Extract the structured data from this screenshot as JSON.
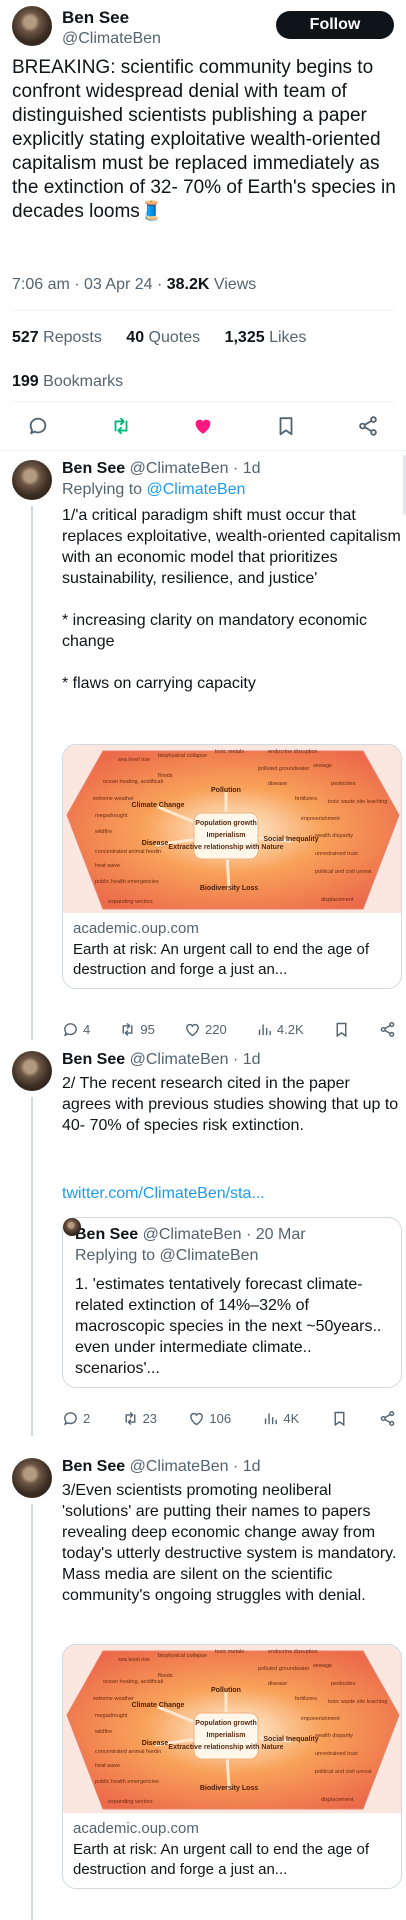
{
  "main": {
    "name": "Ben See",
    "handle": "@ClimateBen",
    "follow_label": "Follow",
    "text": "BREAKING:  scientific community begins to confront widespread denial with team of distinguished scientists publishing a paper explicitly stating exploitative wealth-oriented capitalism must be replaced immediately as the extinction of 32- 70% of Earth's species in decades looms🧵",
    "time": "7:06 am · 03 Apr 24 · ",
    "views_count": "38.2K",
    "views_label": " Views",
    "reposts_count": "527",
    "reposts_label": " Reposts",
    "quotes_count": "40",
    "quotes_label": " Quotes",
    "likes_count": "1,325",
    "likes_label": " Likes",
    "bookmarks_count": "199",
    "bookmarks_label": " Bookmarks"
  },
  "replies": [
    {
      "name": "Ben See",
      "handle_time": " @ClimateBen · 1d",
      "replying_prefix": "Replying to ",
      "replying_to": "@ClimateBen",
      "text": "1/'a critical paradigm shift must occur that replaces exploitative, wealth-oriented capitalism with an economic model that prioritizes sustainability, resilience, and justice'\n\n* increasing clarity on mandatory economic change\n\n* flaws on carrying capacity",
      "card": {
        "domain": "academic.oup.com",
        "title": "Earth at risk: An urgent call to end the age of destruction and forge a just an..."
      },
      "actions": {
        "replies": "4",
        "reposts": "95",
        "likes": "220",
        "views": "4.2K"
      }
    },
    {
      "name": "Ben See",
      "handle_time": " @ClimateBen · 1d",
      "text": "2/ The recent research cited in the paper agrees with previous studies showing that up to 40- 70% of species risk extinction.",
      "link": "twitter.com/ClimateBen/sta...",
      "quote": {
        "name": "Ben See",
        "handle_time": " @ClimateBen · 20 Mar",
        "replying": "Replying to @ClimateBen",
        "text": "1. 'estimates tentatively forecast climate-related extinction of 14%–32% of macroscopic species in the next ~50years.. even under intermediate climate.. scenarios'..."
      },
      "actions": {
        "replies": "2",
        "reposts": "23",
        "likes": "106",
        "views": "4K"
      }
    },
    {
      "name": "Ben See",
      "handle_time": " @ClimateBen · 1d",
      "text": "3/Even scientists promoting neoliberal 'solutions' are putting their names to papers revealing deep economic change away from today's utterly destructive system is mandatory. Mass media are silent on the scientific community's ongoing struggles with denial.",
      "card": {
        "domain": "academic.oup.com",
        "title": "Earth at risk: An urgent call to end the age of destruction and forge a just an..."
      }
    }
  ],
  "infographic": {
    "center": "Population growth\nImperialism\nExtractive relationship with Nature",
    "hubs": [
      "Climate Change",
      "Pollution",
      "Social Inequality",
      "Biodiversity Loss",
      "Disease"
    ],
    "outer": [
      "sea level rise",
      "biophysical collapse",
      "toxic metals",
      "endocrine disruption",
      "ocean heating, acidification, and deoxygenation",
      "floods",
      "polluted groundwater",
      "sewage",
      "disease",
      "pesticides",
      "extreme weather",
      "fertilizers",
      "toxic waste site leaching",
      "megadrought",
      "wildfire",
      "impoverishment",
      "wealth disparity",
      "concentrated animal feeding operations",
      "unrestrained trust",
      "heat wave",
      "public health emergencies",
      "political and civil unrest",
      "expanding vectors",
      "displacement"
    ]
  },
  "colors": {
    "accent": "#1d9bf0",
    "like": "#f91880",
    "repost": "#00ba7c",
    "text": "#0f1419",
    "muted": "#536471"
  }
}
